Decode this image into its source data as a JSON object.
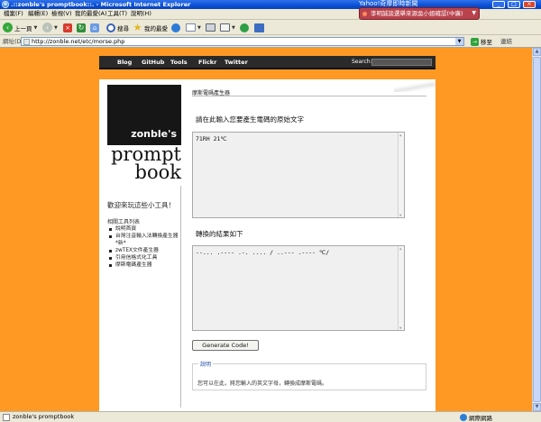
{
  "window": {
    "title": ".::zonble's promptbook::. - Microsoft Internet Explorer",
    "ticker_label": "Yahoo!奇摩即時新聞",
    "ticker_text": "李明誠談選舉來源吳小姐確認(中廣)"
  },
  "menu": [
    "檔案(F)",
    "編輯(E)",
    "檢視(V)",
    "我的最愛(A)",
    "工具(T)",
    "說明(H)"
  ],
  "toolbar": {
    "back": "上一頁",
    "search": "搜尋",
    "favorites": "我的最愛"
  },
  "address": {
    "label": "網址(D)",
    "url": "http://zonble.net/etc/morse.php",
    "go": "移至",
    "links": "連結"
  },
  "site_nav": {
    "links": [
      "Blog",
      "GitHub",
      "Tools",
      "Flickr",
      "Twitter"
    ],
    "search_label": "Search:"
  },
  "sidebar": {
    "logo_top": "zonble's",
    "logo_line1": "prompt",
    "logo_line2": "book",
    "heading": "歡迎來玩這些小工具！",
    "tools_title": "相關工具列表",
    "tools": [
      "說明首頁",
      "台灣注音輸入法轉換產生器 *新*",
      "zwTEX文件產生器",
      "引用信格式化工具",
      "摩斯電碼產生器"
    ]
  },
  "main": {
    "breadcrumb": "摩斯電碼產生器",
    "prompt": "請在此輸入您要產生電碼的原始文字",
    "input_value": "71RH 21℃",
    "result_label": "轉換的結果如下",
    "output_value": "--... .---- .-. .... / ..--- .---- ℃/",
    "button": "Generate Code!",
    "note_legend": "說明",
    "note_text": "您可以在此，將您輸入的英文字母，轉換成摩斯電碼。"
  },
  "status": {
    "text": "zonble's promptbook",
    "zone": "網際網路"
  },
  "colors": {
    "page_background": "#ff9924",
    "site_nav_background": "#2a2a2a",
    "logo_background": "#161616"
  }
}
